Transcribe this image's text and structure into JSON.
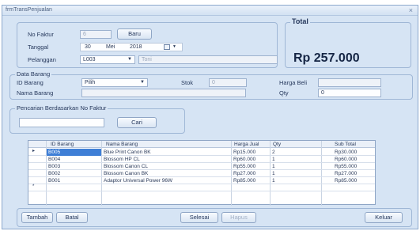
{
  "window": {
    "title": "frmTransPenjualan",
    "close_glyph": "×"
  },
  "header_form": {
    "no_faktur_label": "No Faktur",
    "no_faktur_value": "6",
    "baru_button": "Baru",
    "tanggal_label": "Tanggal",
    "tanggal_day": "30",
    "tanggal_month": "Mei",
    "tanggal_year": "2018",
    "pelanggan_label": "Pelanggan",
    "pelanggan_code": "L003",
    "pelanggan_name": "Toni"
  },
  "total": {
    "legend": "Total",
    "value": "Rp 257.000"
  },
  "data_barang": {
    "legend": "Data Barang",
    "id_barang_label": "ID Barang",
    "id_barang_value": "Pilih",
    "stok_label": "Stok",
    "stok_value": "0",
    "harga_beli_label": "Harga Beli",
    "harga_beli_value": "",
    "nama_barang_label": "Nama Barang",
    "nama_barang_value": "",
    "qty_label": "Qty",
    "qty_value": "0"
  },
  "pencarian": {
    "legend": "Pencarian Berdasarkan No Faktur",
    "input_value": "",
    "cari_button": "Cari"
  },
  "grid": {
    "columns": [
      "ID Barang",
      "Nama Barang",
      "Harga Jual",
      "Qty",
      "Sub Total"
    ],
    "rows": [
      [
        "B005",
        "Blue Print Canon BK",
        "Rp15.000",
        "2",
        "Rp30.000"
      ],
      [
        "B004",
        "Blossom HP CL",
        "Rp60.000",
        "1",
        "Rp60.000"
      ],
      [
        "B003",
        "Blossom Canon CL",
        "Rp55.000",
        "1",
        "Rp55.000"
      ],
      [
        "B002",
        "Blossom Canon BK",
        "Rp27.000",
        "1",
        "Rp27.000"
      ],
      [
        "B001",
        "Adaptor Universal Power 96W",
        "Rp85.000",
        "1",
        "Rp85.000"
      ]
    ],
    "current_row_glyph": "▸",
    "new_row_glyph": "*"
  },
  "buttons": {
    "tambah": "Tambah",
    "batal": "Batal",
    "selesai": "Selesai",
    "hapus": "Hapus",
    "keluar": "Keluar"
  },
  "icons": {
    "dropdown": "▼",
    "calendar": "calendar-icon"
  }
}
